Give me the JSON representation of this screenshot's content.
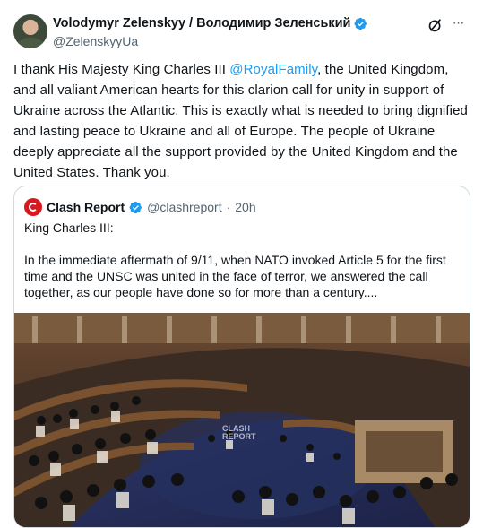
{
  "author": {
    "display_name": "Volodymyr Zelenskyy / Володимир Зеленський",
    "handle": "@ZelenskyyUa",
    "avatar_icon": "profile-photo",
    "verified_icon": "verified-badge-icon",
    "verified_color": "#1d9bf0"
  },
  "actions": {
    "grok_icon": "grok-icon",
    "more_icon": "more-horizontal-icon",
    "more_label": "···"
  },
  "post": {
    "text_before": "I thank His Majesty King Charles III ",
    "mention": "@RoyalFamily",
    "text_after": ", the United Kingdom, and all valiant American hearts for this clarion call for unity in support of Ukraine across the Atlantic. This is exactly what is needed to bring dignified and lasting peace to Ukraine and all of Europe. The people of Ukraine deeply appreciate all the support provided by the United Kingdom and the United States. Thank you."
  },
  "quote": {
    "display_name": "Clash Report",
    "handle": "@clashreport",
    "separator": "·",
    "time": "20h",
    "line1": "King Charles III:",
    "line2": "In the immediate aftermath of 9/11, when NATO invoked Article 5 for the first time and the UNSC was united in the face of terror, we answered the call together, as our people have done so for more than a century....",
    "image_watermark_line1": "CLASH",
    "image_watermark_line2": "REPORT"
  },
  "colors": {
    "text_primary": "#0f1419",
    "text_secondary": "#536471",
    "link": "#1d9bf0",
    "border": "#cfd9de",
    "clash_red": "#d7191f"
  }
}
